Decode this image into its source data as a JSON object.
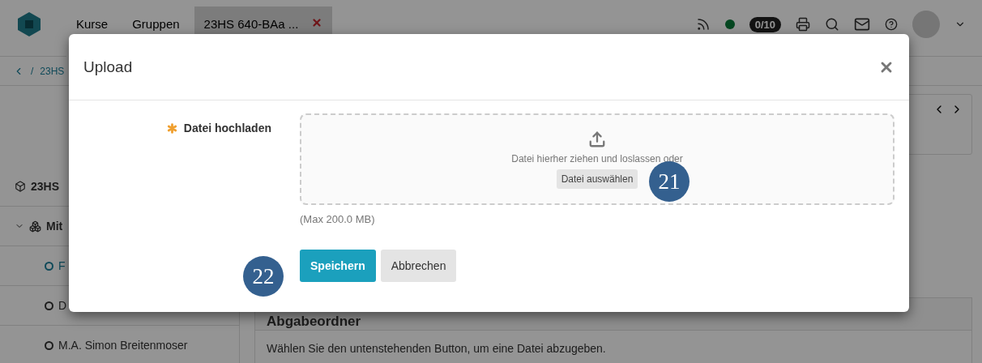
{
  "nav": {
    "items": [
      {
        "label": "Kurse",
        "selected": false
      },
      {
        "label": "Gruppen",
        "selected": false
      },
      {
        "label": "23HS 640-BAa ...",
        "selected": true,
        "closable": true
      }
    ],
    "status_online": true,
    "badge": "0/10"
  },
  "breadcrumb": {
    "separator": "/",
    "label": "23HS"
  },
  "sidebar": {
    "course": "23HS",
    "group": {
      "label": "Mit",
      "expanded": true,
      "children": [
        {
          "label": "F",
          "selected": true
        },
        {
          "label": "D",
          "selected": false
        },
        {
          "label": "M.A. Simon Breitenmoser",
          "selected": false
        }
      ]
    }
  },
  "content": {
    "heading": "Abgabeordner",
    "text": "Wählen Sie den untenstehenden Button, um eine Datei abzugeben."
  },
  "dialog": {
    "title": "Upload",
    "field_label": "Datei hochladen",
    "required": true,
    "drop_text": "Datei hierher ziehen und loslassen oder",
    "choose_button": "Datei auswählen",
    "hint": "(Max 200.0 MB)",
    "buttons": [
      {
        "label": "Speichern",
        "kind": "primary"
      },
      {
        "label": "Abbrechen",
        "kind": "secondary"
      }
    ]
  },
  "annotations": [
    "21",
    "22"
  ]
}
